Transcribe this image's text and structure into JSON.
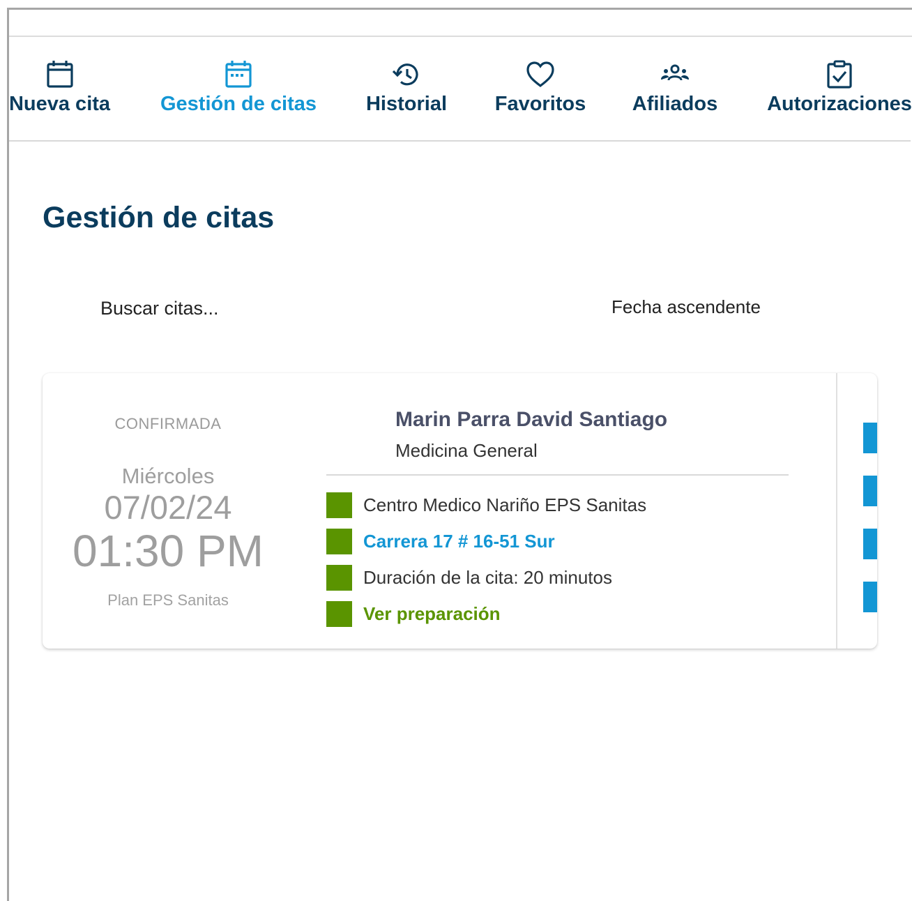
{
  "nav": {
    "items": [
      {
        "label": "Nueva cita",
        "icon": "calendar-icon",
        "active": false
      },
      {
        "label": "Gestión de citas",
        "icon": "calendar-dots-icon",
        "active": true
      },
      {
        "label": "Historial",
        "icon": "history-icon",
        "active": false
      },
      {
        "label": "Favoritos",
        "icon": "heart-icon",
        "active": false
      },
      {
        "label": "Afiliados",
        "icon": "users-group-icon",
        "active": false
      },
      {
        "label": "Autorizaciones",
        "icon": "clipboard-check-icon",
        "active": false
      }
    ]
  },
  "page": {
    "title": "Gestión de citas"
  },
  "search": {
    "placeholder": "Buscar citas..."
  },
  "sort": {
    "selected": "Fecha ascendente"
  },
  "appointment": {
    "status": "CONFIRMADA",
    "weekday": "Miércoles",
    "date": "07/02/24",
    "time": "01:30 PM",
    "plan": "Plan EPS Sanitas",
    "doctor": "Marin Parra David Santiago",
    "specialty": "Medicina General",
    "location": "Centro Medico Nariño EPS Sanitas",
    "address": "Carrera 17 # 16-51 Sur",
    "duration": "Duración de la cita: 20 minutos",
    "preparation": "Ver preparación"
  },
  "colors": {
    "primary_dark": "#0b3c5d",
    "accent_blue": "#1396d4",
    "accent_green": "#5a9400",
    "muted_gray": "#9e9e9e"
  }
}
